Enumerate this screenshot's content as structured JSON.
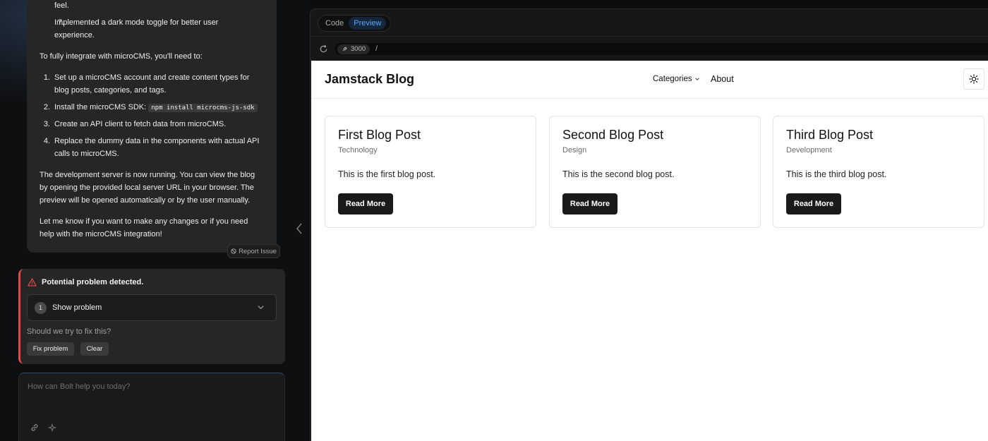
{
  "chat": {
    "items_top": [
      {
        "number": "",
        "text": "feel."
      },
      {
        "number": "7.",
        "text": "Implemented a dark mode toggle for better user"
      },
      {
        "number": "",
        "text": "experience."
      }
    ],
    "integrate_intro": "To fully integrate with microCMS, you'll need to:",
    "steps": [
      {
        "number": "1.",
        "line1": "Set up a microCMS account and create content types for",
        "line2": "blog posts, categories, and tags."
      },
      {
        "number": "2.",
        "line1": "Install the microCMS SDK:",
        "code": "npm install microcms-js-sdk"
      },
      {
        "number": "3.",
        "line1": "Create an API client to fetch data from microCMS."
      },
      {
        "number": "4.",
        "line1": "Replace the dummy data in the components with actual API",
        "line2": "calls to microCMS."
      }
    ],
    "server_para": [
      "The development server is now running. You can view the blog",
      "by opening the provided local server URL in your browser. The",
      "preview will be opened automatically or by the user manually."
    ],
    "closing_para": [
      "Let me know if you want to make any changes or if you need",
      "help with the microCMS integration!"
    ],
    "report_issue": "Report Issue"
  },
  "problem": {
    "title": "Potential problem detected.",
    "count": "1",
    "show_label": "Show problem",
    "question": "Should we try to fix this?",
    "fix_label": "Fix problem",
    "clear_label": "Clear",
    "accent": "#e5484d"
  },
  "input": {
    "placeholder": "How can Bolt help you today?",
    "link_icon": "link-icon",
    "sparkle_icon": "sparkle-icon"
  },
  "workbench": {
    "tabs": [
      {
        "label": "Code",
        "active": false
      },
      {
        "label": "Preview",
        "active": true
      }
    ],
    "port": "3000",
    "path": "/"
  },
  "site": {
    "brand": "Jamstack Blog",
    "nav_categories": "Categories",
    "nav_about": "About",
    "posts": [
      {
        "title": "First Blog Post",
        "category": "Technology",
        "excerpt": "This is the first blog post.",
        "cta": "Read More"
      },
      {
        "title": "Second Blog Post",
        "category": "Design",
        "excerpt": "This is the second blog post.",
        "cta": "Read More"
      },
      {
        "title": "Third Blog Post",
        "category": "Development",
        "excerpt": "This is the third blog post.",
        "cta": "Read More"
      }
    ]
  },
  "colors": {
    "accent_blue": "#5aa7ff",
    "panel": "#262626",
    "page_bg": "#0d0d0d"
  }
}
